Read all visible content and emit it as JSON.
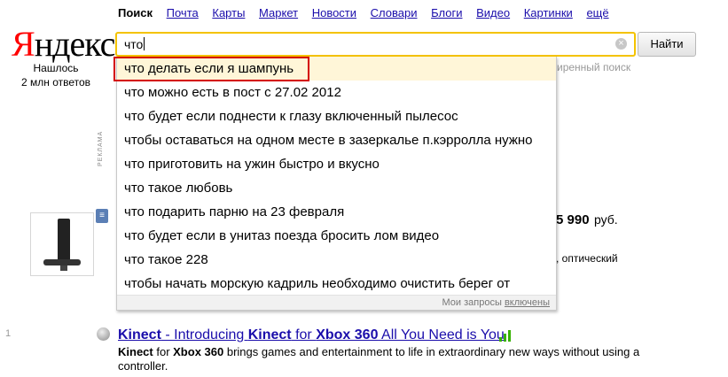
{
  "nav": {
    "active": "Поиск",
    "links": [
      "Почта",
      "Карты",
      "Маркет",
      "Новости",
      "Словари",
      "Блоги",
      "Видео",
      "Картинки",
      "ещё"
    ]
  },
  "logo": {
    "first": "Я",
    "rest": "ндекс"
  },
  "found": {
    "line1": "Нашлось",
    "line2": "2 млн ответов"
  },
  "search": {
    "value": "что",
    "clear_icon": "×",
    "button_label": "Найти"
  },
  "ad_label": "РЕКЛАМА",
  "background": {
    "secure_search": "иренный поиск",
    "price_value": "5 990",
    "price_currency": "руб.",
    "optical": ", оптический"
  },
  "suggestions": [
    "что делать если я шампунь",
    "что можно есть в пост с 27.02 2012",
    "что будет если поднести к глазу включенный пылесос",
    "чтобы оставаться на одном месте в зазеркалье п.кэрролла нужно",
    "что приготовить на ужин быстро и вкусно",
    "что такое любовь",
    "что подарить парню на 23 февраля",
    "что будет если в унитаз поезда бросить лом видео",
    "что такое 228",
    "чтобы начать морскую кадриль необходимо очистить берег от"
  ],
  "suggest_footer": {
    "text": "Мои запросы",
    "link": "включены"
  },
  "result": {
    "number": "1",
    "title_bold1": "Kinect",
    "title_mid": " - Introducing ",
    "title_bold2": "Kinect",
    "title_for": " for ",
    "title_bold3": "Xbox 360",
    "title_end": " All You Need is You",
    "snippet_bold1": "Kinect",
    "snippet_for": " for ",
    "snippet_bold2": "Xbox 360",
    "snippet_rest": " brings games and entertainment to life in extraordinary new ways without using a controller."
  },
  "colors": {
    "accent_red": "#ff0000",
    "link_blue": "#1a0dab",
    "search_border": "#f4c300",
    "highlight_box": "#d40000",
    "relevance_green": "#37b200"
  }
}
